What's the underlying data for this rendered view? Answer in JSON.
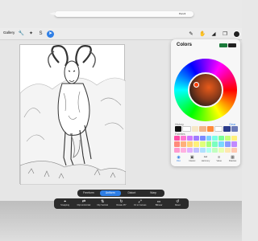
{
  "pencil": {
    "brand": "Pencil"
  },
  "topbar": {
    "gallery_label": "Gallery",
    "left_tools": [
      {
        "icon": "wrench-icon",
        "glyph": "🔧"
      },
      {
        "icon": "magic-wand-icon",
        "glyph": "✦"
      },
      {
        "icon": "adjustments-icon",
        "glyph": "S"
      },
      {
        "icon": "selection-arrow-icon",
        "glyph": "➤"
      }
    ],
    "right_tools": [
      {
        "icon": "brush-icon",
        "glyph": "✎"
      },
      {
        "icon": "smudge-icon",
        "glyph": "✋"
      },
      {
        "icon": "eraser-icon",
        "glyph": "◢"
      },
      {
        "icon": "layers-icon",
        "glyph": "❐"
      }
    ],
    "current_color": "#222222"
  },
  "colors_panel": {
    "title": "Colors",
    "current_swatch": "#222222",
    "previous_swatch": "#1a7a3a",
    "history_label": "History",
    "clear_label": "Clear",
    "history": [
      "#111111",
      "#ffffff",
      "#f6e7c6",
      "#f2b48a",
      "#ff8a3a",
      "#ffffff",
      "#2a3a8a",
      "#6a7ab8"
    ],
    "palettes_label": "Palettes",
    "palette": [
      "#ff4da6",
      "#ff7ad0",
      "#d07aff",
      "#a07aff",
      "#7a8aff",
      "#7ad0ff",
      "#7affe6",
      "#7aff9a",
      "#c6ff7a",
      "#ffef7a",
      "#ff8a7a",
      "#ffb07a",
      "#ffd27a",
      "#fff07a",
      "#e0ff7a",
      "#a6ff7a",
      "#7affc0",
      "#7ad8ff",
      "#8a9aff",
      "#c08aff",
      "#ff9ad0",
      "#ffb0e0",
      "#e0b0ff",
      "#c0c0ff",
      "#b0e0ff",
      "#b0fff0",
      "#c0ffc0",
      "#e8ffb0",
      "#ffe8b0",
      "#ffc8b0"
    ],
    "modes": [
      {
        "label": "Disc",
        "icon": "disc-icon",
        "glyph": "◉",
        "active": true
      },
      {
        "label": "Classic",
        "icon": "classic-icon",
        "glyph": "▣",
        "active": false
      },
      {
        "label": "Harmony",
        "icon": "harmony-icon",
        "glyph": "⚯",
        "active": false
      },
      {
        "label": "Value",
        "icon": "value-icon",
        "glyph": "≡",
        "active": false
      },
      {
        "label": "Palettes",
        "icon": "palettes-icon",
        "glyph": "▦",
        "active": false
      }
    ]
  },
  "selection_bar": {
    "tabs": [
      {
        "label": "Freeform",
        "active": false
      },
      {
        "label": "Uniform",
        "active": true
      },
      {
        "label": "Distort",
        "active": false
      },
      {
        "label": "Warp",
        "active": false
      }
    ]
  },
  "transform_tools": [
    {
      "label": "Snapping",
      "icon": "snapping-icon",
      "glyph": "⌖"
    },
    {
      "label": "Flip Horizontal",
      "icon": "flip-horizontal-icon",
      "glyph": "⇄"
    },
    {
      "label": "Flip Vertical",
      "icon": "flip-vertical-icon",
      "glyph": "⇅"
    },
    {
      "label": "Rotate 45°",
      "icon": "rotate-icon",
      "glyph": "↻"
    },
    {
      "label": "Fit to Canvas",
      "icon": "fit-canvas-icon",
      "glyph": "⤢"
    },
    {
      "label": "Bilinear",
      "icon": "bilinear-icon",
      "glyph": "⚏"
    },
    {
      "label": "Reset",
      "icon": "reset-icon",
      "glyph": "↺"
    }
  ]
}
